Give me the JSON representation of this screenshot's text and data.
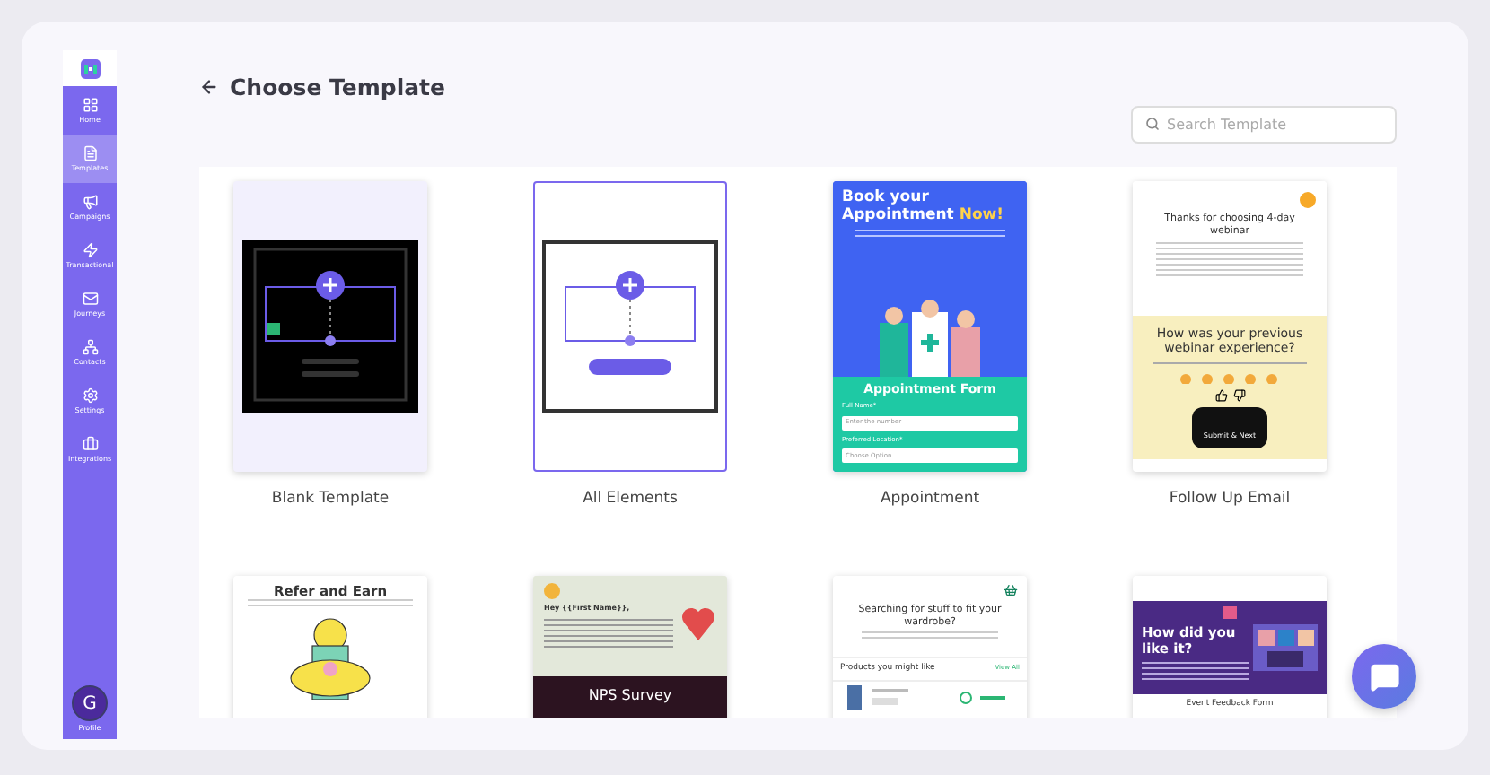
{
  "sidebar": {
    "items": [
      {
        "label": "Home",
        "selected": false
      },
      {
        "label": "Templates",
        "selected": true
      },
      {
        "label": "Campaigns",
        "selected": false
      },
      {
        "label": "Transactional",
        "selected": false
      },
      {
        "label": "Journeys",
        "selected": false
      },
      {
        "label": "Contacts",
        "selected": false
      },
      {
        "label": "Settings",
        "selected": false
      },
      {
        "label": "Integrations",
        "selected": false
      }
    ],
    "profile": {
      "initial": "G",
      "label": "Profile"
    }
  },
  "header": {
    "title": "Choose Template",
    "search": {
      "placeholder": "Search Template"
    }
  },
  "templates": [
    {
      "kind": "blank",
      "name": "Blank Template",
      "selected": false
    },
    {
      "kind": "elements",
      "name": "All Elements",
      "selected": true
    },
    {
      "kind": "appointment",
      "name": "Appointment",
      "selected": false,
      "heading": "Book your",
      "heading_2": "Appointment",
      "highlight": "Now!",
      "form_title": "Appointment Form",
      "field_label": "Full Name*",
      "field_placeholder": "Enter the number",
      "select_label": "Preferred Location*",
      "select_value": "Choose Option"
    },
    {
      "kind": "webinar",
      "name": "Follow Up Email",
      "selected": false,
      "heading": "Thanks for choosing 4-day webinar",
      "question": "How was your previous webinar experience?",
      "button": "Submit & Next"
    },
    {
      "kind": "referral",
      "heading": "Refer and Earn"
    },
    {
      "kind": "nps",
      "greeting": "Hey {{First Name}},",
      "heading": "NPS Survey"
    },
    {
      "kind": "wardrobe",
      "heading": "Searching for stuff to fit your wardrobe?",
      "section": "Products you might like",
      "link": "View All"
    },
    {
      "kind": "event",
      "heading": "How did you like it?",
      "caption": "Event Feedback Form"
    }
  ]
}
